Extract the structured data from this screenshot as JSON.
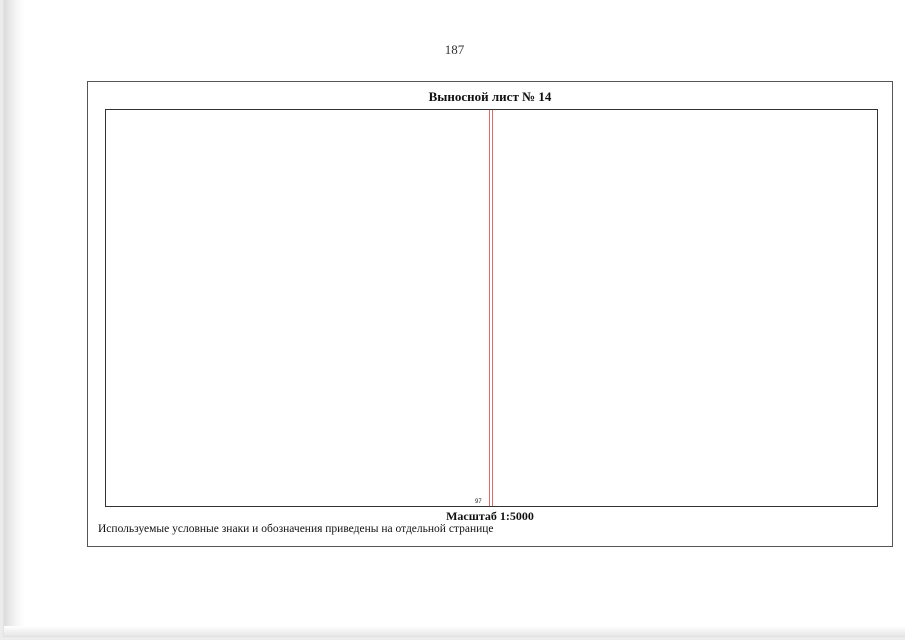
{
  "page": {
    "number": "187"
  },
  "sheet": {
    "title": "Выносной лист № 14",
    "map": {
      "parcel_label": "97"
    },
    "scale": "Масштаб 1:5000",
    "legend_note": "Используемые условные знаки и обозначения приведены на отдельной странице"
  },
  "colors": {
    "boundary": "#e06a6a",
    "frame": "#333333"
  }
}
